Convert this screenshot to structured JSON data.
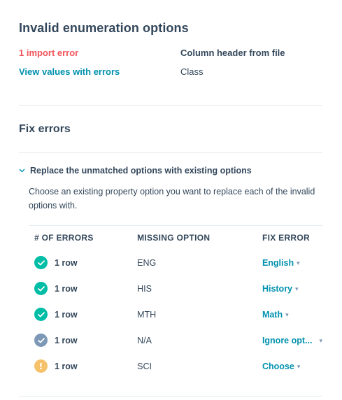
{
  "heading": "Invalid enumeration options",
  "summary": {
    "error_link": "1 import error",
    "view_link": "View values with errors",
    "column_header_label": "Column header from file",
    "column_header_value": "Class"
  },
  "fix_section": {
    "title": "Fix errors",
    "replace_toggle": "Replace the unmatched options with existing options",
    "description": "Choose an existing property option you want to replace each of the invalid options with.",
    "table": {
      "headers": {
        "errors": "# OF ERRORS",
        "missing": "MISSING OPTION",
        "fix": "FIX ERROR"
      },
      "rows": [
        {
          "count": "1 row",
          "missing": "ENG",
          "fix": "English",
          "status": "ok"
        },
        {
          "count": "1 row",
          "missing": "HIS",
          "fix": "History",
          "status": "ok"
        },
        {
          "count": "1 row",
          "missing": "MTH",
          "fix": "Math",
          "status": "ok"
        },
        {
          "count": "1 row",
          "missing": "N/A",
          "fix": "Ignore opt...",
          "status": "ignored"
        },
        {
          "count": "1 row",
          "missing": "SCI",
          "fix": "Choose",
          "status": "warn"
        }
      ]
    }
  },
  "colors": {
    "error": "#f2545b",
    "link": "#0091ae",
    "text": "#33475b",
    "ok": "#00bda5",
    "ignored": "#7c98b6",
    "warn": "#f5c26b",
    "divider": "#e5ebf0"
  }
}
